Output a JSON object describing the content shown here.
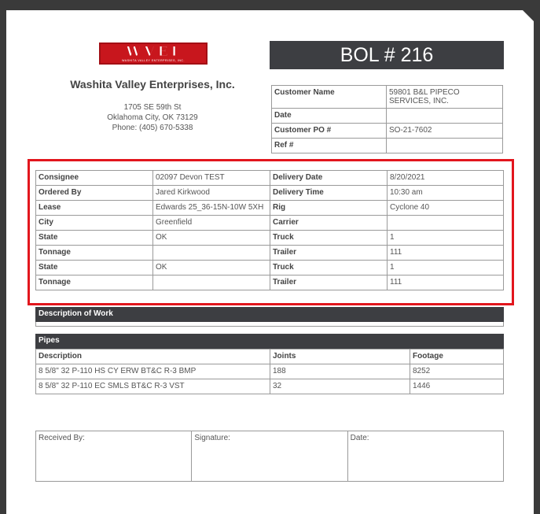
{
  "company": {
    "logo_text": "WVEI",
    "logo_subtext": "WASHITA VALLEY ENTERPRISES, INC.",
    "name": "Washita Valley Enterprises, Inc.",
    "address1": "1705 SE 59th St",
    "address2": "Oklahoma City, OK 73129",
    "phone": "Phone: (405) 670-5338"
  },
  "bol_title": "BOL # 216",
  "customer": {
    "rows": [
      {
        "label": "Customer Name",
        "value": "59801 B&L PIPECO SERVICES, INC."
      },
      {
        "label": "Date",
        "value": ""
      },
      {
        "label": "Customer PO #",
        "value": "SO-21-7602"
      },
      {
        "label": "Ref #",
        "value": ""
      }
    ]
  },
  "consignee": {
    "rows": [
      {
        "l1": "Consignee",
        "v1": "02097 Devon TEST",
        "l2": "Delivery Date",
        "v2": "8/20/2021"
      },
      {
        "l1": "Ordered By",
        "v1": "Jared Kirkwood",
        "l2": "Delivery Time",
        "v2": "10:30 am"
      },
      {
        "l1": "Lease",
        "v1": "Edwards 25_36-15N-10W 5XH",
        "l2": "Rig",
        "v2": "Cyclone 40"
      },
      {
        "l1": "City",
        "v1": "Greenfield",
        "l2": "Carrier",
        "v2": ""
      },
      {
        "l1": "State",
        "v1": "OK",
        "l2": "Truck",
        "v2": "1"
      },
      {
        "l1": "Tonnage",
        "v1": "",
        "l2": "Trailer",
        "v2": "111"
      },
      {
        "l1": "State",
        "v1": "OK",
        "l2": "Truck",
        "v2": "1"
      },
      {
        "l1": "Tonnage",
        "v1": "",
        "l2": "Trailer",
        "v2": "111"
      }
    ]
  },
  "description_of_work": {
    "title": "Description of Work"
  },
  "pipes": {
    "title": "Pipes",
    "headers": [
      "Description",
      "Joints",
      "Footage"
    ],
    "rows": [
      [
        "8 5/8\" 32 P-110 HS CY ERW BT&C R-3 BMP",
        "188",
        "8252"
      ],
      [
        "8 5/8\" 32 P-110 EC SMLS BT&C R-3 VST",
        "32",
        "1446"
      ]
    ]
  },
  "signature": {
    "received_by": "Received By:",
    "signature": "Signature:",
    "date": "Date:"
  }
}
